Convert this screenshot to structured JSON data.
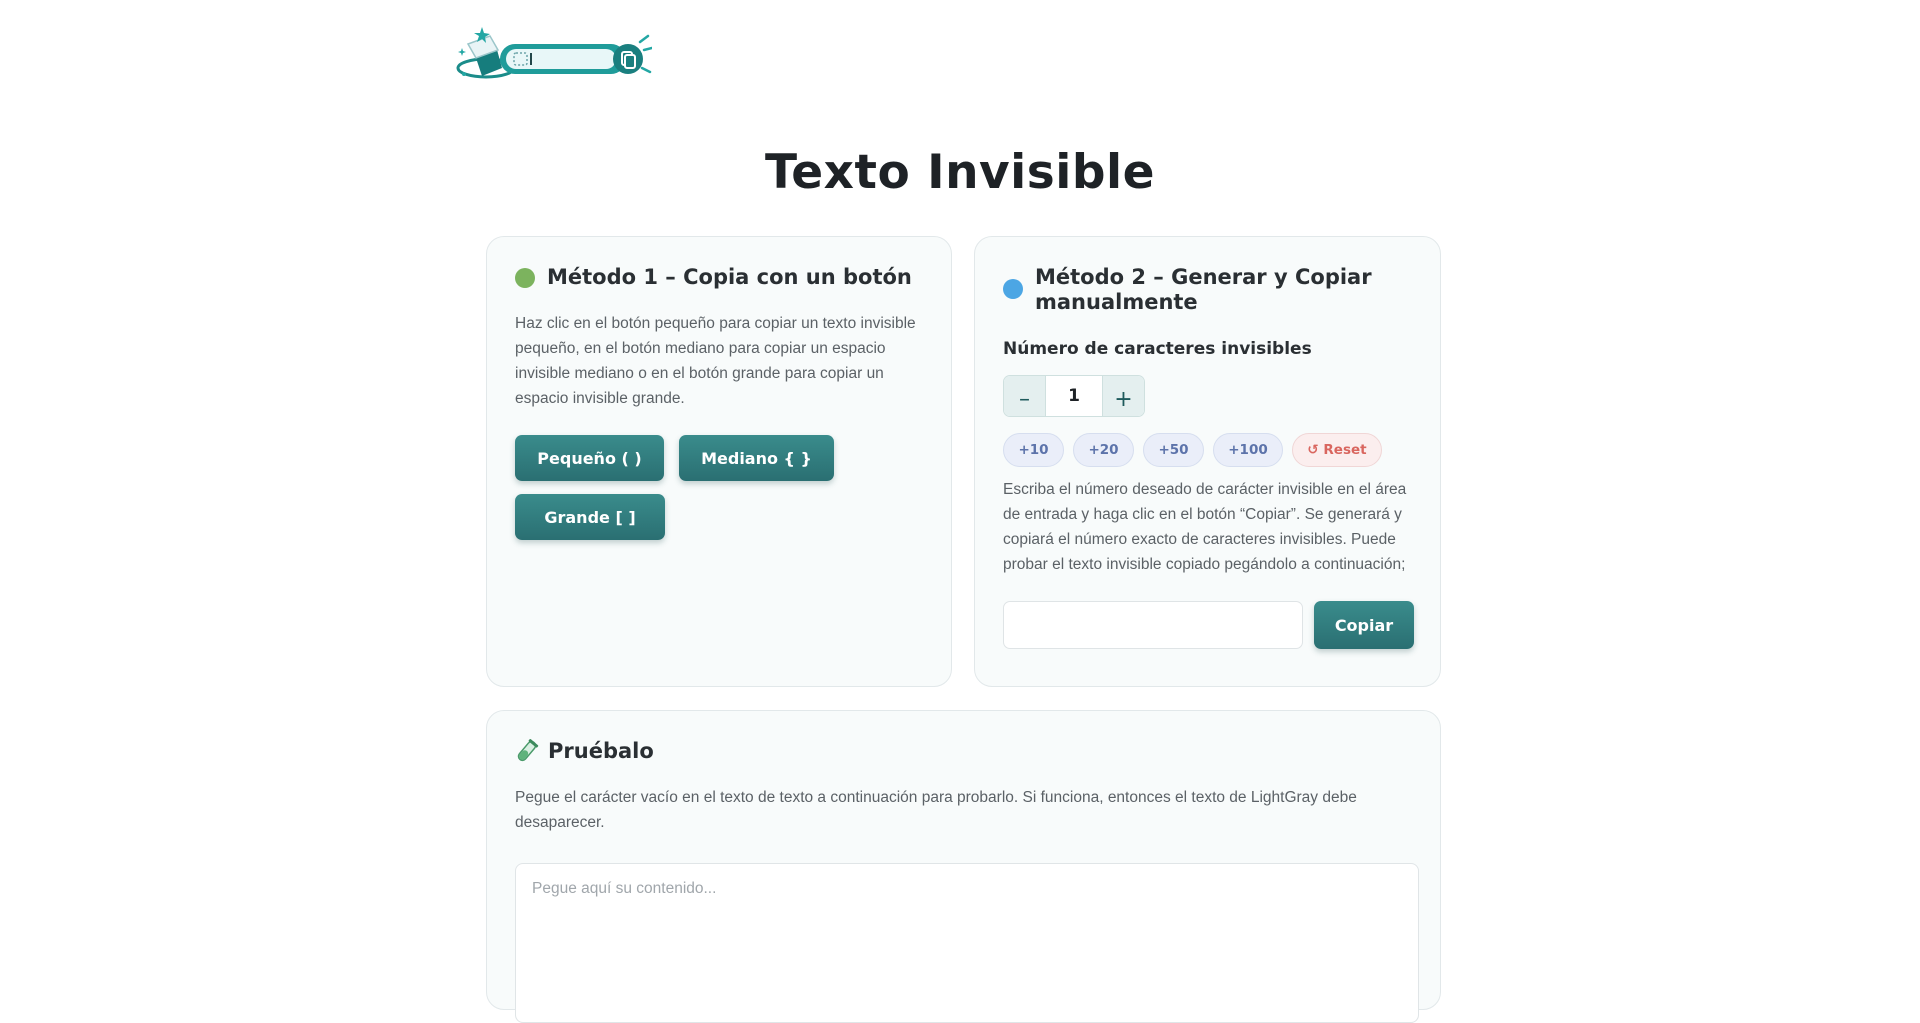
{
  "page": {
    "title": "Texto Invisible"
  },
  "method1": {
    "title": "Método 1 – Copia con un botón",
    "dot_color": "#7cb35e",
    "description": "Haz clic en el botón pequeño para copiar un texto invisible pequeño, en el botón mediano para copiar un espacio invisible mediano o en el botón grande para copiar un espacio invisible grande.",
    "buttons": {
      "small": "Pequeño (  )",
      "medium": "Mediano {  }",
      "large": "Grande [    ]"
    }
  },
  "method2": {
    "title": "Método 2 – Generar y Copiar manualmente",
    "dot_color": "#4ca6e4",
    "count_label": "Número de caracteres invisibles",
    "stepper": {
      "minus": "–",
      "value": "1",
      "plus": "+"
    },
    "presets": [
      "+10",
      "+20",
      "+50",
      "+100"
    ],
    "reset": "↺ Reset",
    "description": "Escriba el número deseado de carácter invisible en el área de entrada y haga clic en el botón “Copiar”. Se generará y copiará el número exacto de caracteres invisibles. Puede probar el texto invisible copiado pegándolo a continuación;",
    "input_value": "",
    "copy_button": "Copiar"
  },
  "tryit": {
    "icon": "test-tube-icon",
    "title": "Pruébalo",
    "description": "Pegue el carácter vacío en el texto de texto a continuación para probarlo. Si funciona, entonces el texto de LightGray debe desaparecer.",
    "placeholder": "Pegue aquí su contenido..."
  },
  "colors": {
    "accent": "#2f7a7c",
    "accent_light": "#3a8c8c"
  }
}
